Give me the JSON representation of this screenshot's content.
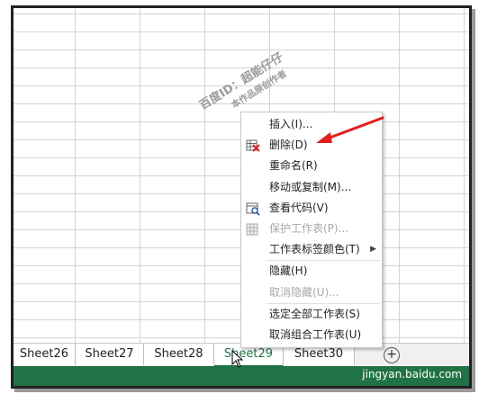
{
  "watermark": {
    "line1": "百度ID：超能仔仔",
    "line2": "本作品原创作者"
  },
  "context_menu": {
    "items": [
      {
        "label": "插入(I)...",
        "icon": "",
        "disabled": false,
        "submenu": false
      },
      {
        "label": "删除(D)",
        "icon": "delete-sheet-icon",
        "disabled": false,
        "submenu": false
      },
      {
        "label": "重命名(R)",
        "icon": "",
        "disabled": false,
        "submenu": false
      },
      {
        "label": "移动或复制(M)...",
        "icon": "",
        "disabled": false,
        "submenu": false
      },
      {
        "label": "查看代码(V)",
        "icon": "view-code-icon",
        "disabled": false,
        "submenu": false
      },
      {
        "label": "保护工作表(P)...",
        "icon": "protect-sheet-icon",
        "disabled": true,
        "submenu": false
      },
      {
        "label": "工作表标签颜色(T)",
        "icon": "",
        "disabled": false,
        "submenu": true
      },
      {
        "label": "隐藏(H)",
        "icon": "",
        "disabled": false,
        "submenu": false
      },
      {
        "label": "取消隐藏(U)...",
        "icon": "",
        "disabled": true,
        "submenu": false
      },
      {
        "label": "选定全部工作表(S)",
        "icon": "",
        "disabled": false,
        "submenu": false
      },
      {
        "label": "取消组合工作表(U)",
        "icon": "",
        "disabled": false,
        "submenu": false
      }
    ]
  },
  "sheet_tabs": [
    {
      "label": "Sheet26",
      "state": "normal"
    },
    {
      "label": "Sheet27",
      "state": "normal"
    },
    {
      "label": "Sheet28",
      "state": "normal"
    },
    {
      "label": "Sheet29",
      "state": "active"
    },
    {
      "label": "Sheet30",
      "state": "normal"
    }
  ],
  "add_sheet_symbol": "+",
  "footer": {
    "brand": "jingyan.baidu.com"
  },
  "colors": {
    "excel_green": "#217346",
    "annotation_red": "#e02020",
    "menu_border": "#c6c6c6"
  }
}
